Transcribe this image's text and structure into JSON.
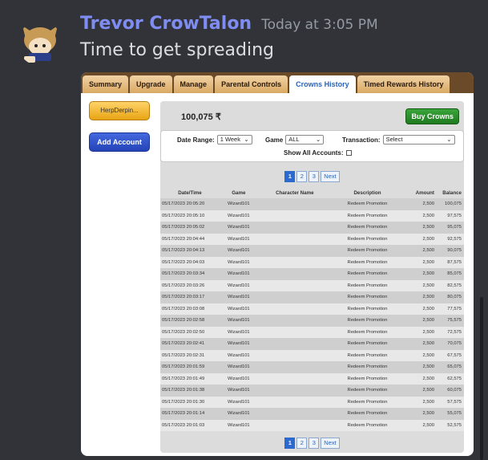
{
  "message": {
    "username": "Trevor CrowTalon",
    "timestamp": "Today at 3:05 PM",
    "text": "Time to get spreading"
  },
  "colors": {
    "username": "#7f8df3",
    "tab_bar": "#6b4a29",
    "buy_button": "#2e8b2e",
    "add_account": "#2b4fc7"
  },
  "tabs": [
    {
      "label": "Summary",
      "active": false
    },
    {
      "label": "Upgrade",
      "active": false
    },
    {
      "label": "Manage",
      "active": false
    },
    {
      "label": "Parental Controls",
      "active": false
    },
    {
      "label": "Crowns History",
      "active": true
    },
    {
      "label": "Timed Rewards History",
      "active": false
    }
  ],
  "sidebar": {
    "account_button": "HerpDerpin...",
    "add_account": "Add Account"
  },
  "crowns": {
    "balance": "100,075 ₹",
    "buy_label": "Buy Crowns"
  },
  "filters": {
    "date_range_label": "Date Range:",
    "date_range_value": "1 Week",
    "game_label": "Game",
    "game_value": "ALL",
    "transaction_label": "Transaction:",
    "transaction_value": "Select",
    "show_all_label": "Show All Accounts:"
  },
  "pager": {
    "pages": [
      "1",
      "2",
      "3"
    ],
    "active_page": "1",
    "next_label": "Next"
  },
  "table": {
    "headers": [
      "Date/Time",
      "Game",
      "Character Name",
      "Description",
      "Amount",
      "Balance"
    ],
    "rows": [
      [
        "05/17/2023 20:05:20",
        "Wizard101",
        "",
        "Redeem Promotion",
        "2,500",
        "100,075"
      ],
      [
        "05/17/2023 20:05:10",
        "Wizard101",
        "",
        "Redeem Promotion",
        "2,500",
        "97,575"
      ],
      [
        "05/17/2023 20:05:02",
        "Wizard101",
        "",
        "Redeem Promotion",
        "2,500",
        "95,075"
      ],
      [
        "05/17/2023 20:04:44",
        "Wizard101",
        "",
        "Redeem Promotion",
        "2,500",
        "92,575"
      ],
      [
        "05/17/2023 20:04:13",
        "Wizard101",
        "",
        "Redeem Promotion",
        "2,500",
        "90,075"
      ],
      [
        "05/17/2023 20:04:03",
        "Wizard101",
        "",
        "Redeem Promotion",
        "2,500",
        "87,575"
      ],
      [
        "05/17/2023 20:03:34",
        "Wizard101",
        "",
        "Redeem Promotion",
        "2,500",
        "85,075"
      ],
      [
        "05/17/2023 20:03:26",
        "Wizard101",
        "",
        "Redeem Promotion",
        "2,500",
        "82,575"
      ],
      [
        "05/17/2023 20:03:17",
        "Wizard101",
        "",
        "Redeem Promotion",
        "2,500",
        "80,075"
      ],
      [
        "05/17/2023 20:03:08",
        "Wizard101",
        "",
        "Redeem Promotion",
        "2,500",
        "77,575"
      ],
      [
        "05/17/2023 20:02:58",
        "Wizard101",
        "",
        "Redeem Promotion",
        "2,500",
        "75,575"
      ],
      [
        "05/17/2023 20:02:50",
        "Wizard101",
        "",
        "Redeem Promotion",
        "2,500",
        "72,575"
      ],
      [
        "05/17/2023 20:02:41",
        "Wizard101",
        "",
        "Redeem Promotion",
        "2,500",
        "70,075"
      ],
      [
        "05/17/2023 20:02:31",
        "Wizard101",
        "",
        "Redeem Promotion",
        "2,500",
        "67,575"
      ],
      [
        "05/17/2023 20:01:59",
        "Wizard101",
        "",
        "Redeem Promotion",
        "2,500",
        "65,075"
      ],
      [
        "05/17/2023 20:01:49",
        "Wizard101",
        "",
        "Redeem Promotion",
        "2,500",
        "62,575"
      ],
      [
        "05/17/2023 20:01:38",
        "Wizard101",
        "",
        "Redeem Promotion",
        "2,500",
        "60,075"
      ],
      [
        "05/17/2023 20:01:30",
        "Wizard101",
        "",
        "Redeem Promotion",
        "2,500",
        "57,575"
      ],
      [
        "05/17/2023 20:01:14",
        "Wizard101",
        "",
        "Redeem Promotion",
        "2,500",
        "55,075"
      ],
      [
        "05/17/2023 20:01:03",
        "Wizard101",
        "",
        "Redeem Promotion",
        "2,500",
        "52,575"
      ]
    ]
  }
}
